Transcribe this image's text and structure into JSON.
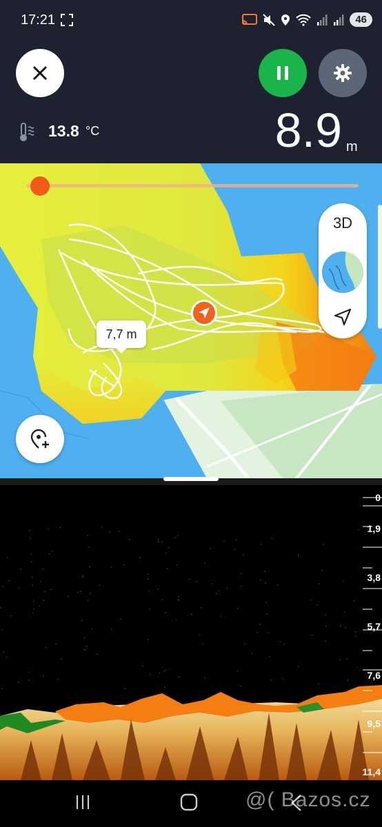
{
  "status_bar": {
    "time": "17:21",
    "battery": "46"
  },
  "header": {
    "temperature_value": "13.8",
    "temperature_unit": "°C",
    "depth_value": "8.9",
    "depth_unit": "m"
  },
  "map": {
    "depth_tooltip": "7,7 m",
    "view_toggle_label": "3D",
    "colors": {
      "water": "#4fb0f0",
      "shallow": "#e3ee3a",
      "mid": "#b7d94a",
      "deep": "#f57c12",
      "track": "#ffffff",
      "boat_marker": "#f2621a"
    }
  },
  "sonar": {
    "scale_labels": [
      "0",
      "1,9",
      "3,8",
      "5,7",
      "7,6",
      "9,5",
      "11,4"
    ]
  },
  "controls": {
    "pause_color": "#1bb44b",
    "settings_color": "#5d6677"
  },
  "watermark": "@( Bazos.cz"
}
